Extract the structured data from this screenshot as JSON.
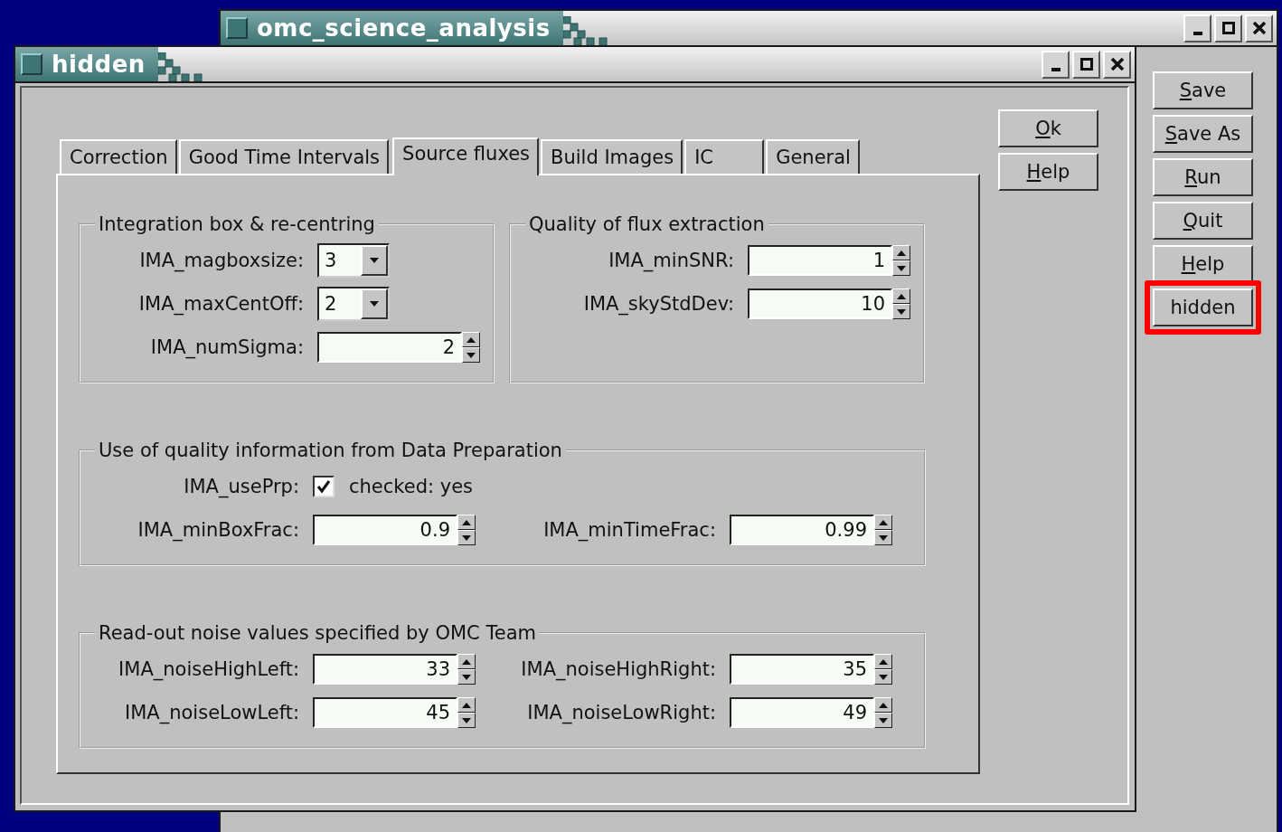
{
  "main_window": {
    "title": "omc_science_analysis",
    "buttons": [
      {
        "label": "Save",
        "mnemonic": true,
        "highlighted": false
      },
      {
        "label": "Save As",
        "mnemonic": true,
        "highlighted": false
      },
      {
        "label": "Run",
        "mnemonic": true,
        "highlighted": false
      },
      {
        "label": "Quit",
        "mnemonic": true,
        "highlighted": false
      },
      {
        "label": "Help",
        "mnemonic": true,
        "highlighted": false
      },
      {
        "label": "hidden",
        "mnemonic": false,
        "highlighted": true
      }
    ]
  },
  "dialog": {
    "title": "hidden",
    "tabs": [
      {
        "label": "Correction",
        "selected": false
      },
      {
        "label": "Good Time Intervals",
        "selected": false
      },
      {
        "label": "Source fluxes",
        "selected": true
      },
      {
        "label": "Build Images",
        "selected": false
      },
      {
        "label": "IC",
        "selected": false
      },
      {
        "label": "General",
        "selected": false
      }
    ],
    "sections": [
      {
        "groups": [
          {
            "title": "Integration box & re-centring",
            "rows": [
              [
                {
                  "kind": "combo",
                  "label": "IMA_magboxsize:",
                  "value": "3"
                }
              ],
              [
                {
                  "kind": "combo",
                  "label": "IMA_maxCentOff:",
                  "value": "2"
                }
              ],
              [
                {
                  "kind": "spin",
                  "label": "IMA_numSigma:",
                  "value": "2"
                }
              ]
            ]
          },
          {
            "title": "Quality of flux extraction",
            "rows": [
              [
                {
                  "kind": "spin",
                  "label": "IMA_minSNR:",
                  "value": "1"
                }
              ],
              [
                {
                  "kind": "spin",
                  "label": "IMA_skyStdDev:",
                  "value": "10"
                }
              ]
            ]
          }
        ]
      },
      {
        "groups": [
          {
            "title": "Use of quality information from Data Preparation",
            "rows": [
              [
                {
                  "kind": "check",
                  "label": "IMA_usePrp:",
                  "checked": true,
                  "caption": "checked: yes"
                }
              ],
              [
                {
                  "kind": "spin",
                  "label": "IMA_minBoxFrac:",
                  "value": "0.9"
                },
                {
                  "kind": "spin",
                  "label": "IMA_minTimeFrac:",
                  "value": "0.99"
                }
              ]
            ]
          }
        ]
      },
      {
        "groups": [
          {
            "title": "Read-out noise values specified by OMC Team",
            "rows": [
              [
                {
                  "kind": "spin",
                  "label": "IMA_noiseHighLeft:",
                  "value": "33"
                },
                {
                  "kind": "spin",
                  "label": "IMA_noiseHighRight:",
                  "value": "35"
                }
              ],
              [
                {
                  "kind": "spin",
                  "label": "IMA_noiseLowLeft:",
                  "value": "45"
                },
                {
                  "kind": "spin",
                  "label": "IMA_noiseLowRight:",
                  "value": "49"
                }
              ]
            ]
          }
        ]
      }
    ],
    "buttons": [
      {
        "label": "Ok",
        "mnemonic": true,
        "highlighted": false
      },
      {
        "label": "Help",
        "mnemonic": true,
        "highlighted": false
      }
    ]
  }
}
